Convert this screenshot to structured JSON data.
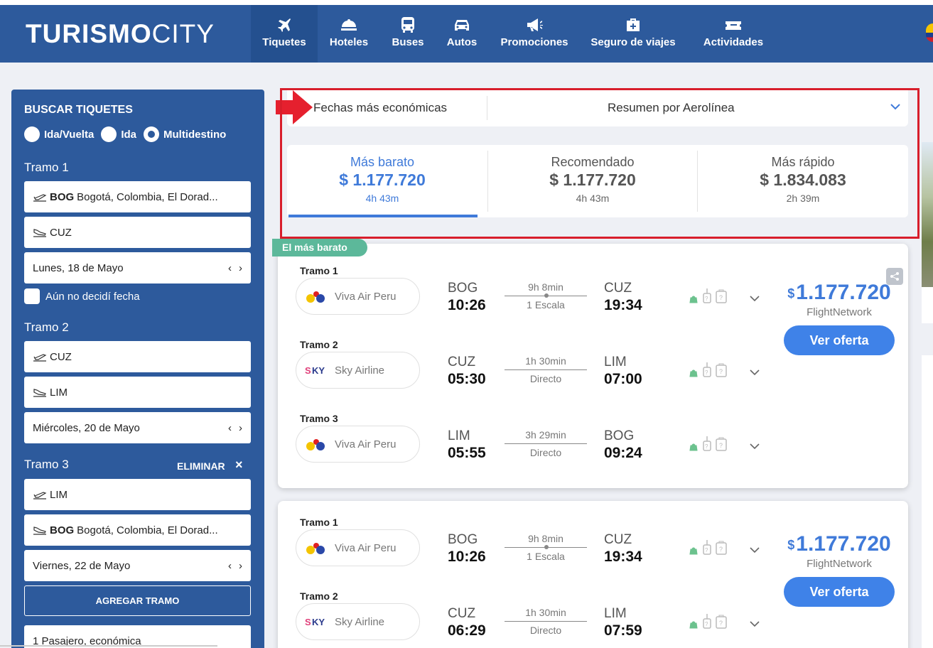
{
  "header": {
    "logo_bold": "TURISMO",
    "logo_light": "CITY",
    "nav": [
      {
        "label": "Tiquetes",
        "icon": "plane-icon",
        "active": true
      },
      {
        "label": "Hoteles",
        "icon": "hotel-bell-icon",
        "active": false
      },
      {
        "label": "Buses",
        "icon": "bus-icon",
        "active": false
      },
      {
        "label": "Autos",
        "icon": "car-icon",
        "active": false
      },
      {
        "label": "Promociones",
        "icon": "megaphone-icon",
        "active": false
      },
      {
        "label": "Seguro de viajes",
        "icon": "medical-case-icon",
        "active": false
      },
      {
        "label": "Actividades",
        "icon": "ticket-icon",
        "active": false
      }
    ]
  },
  "sidebar": {
    "title": "BUSCAR TIQUETES",
    "trip_types": [
      "Ida/Vuelta",
      "Ida",
      "Multidestino"
    ],
    "selected_trip_type": "Multidestino",
    "undecided_date": "Aún no decidí fecha",
    "tramos": [
      {
        "label": "Tramo 1",
        "origin_code": "BOG",
        "origin_name": "Bogotá, Colombia, El Dorad...",
        "dest_code": "",
        "dest_name": "CUZ",
        "date": "Lunes, 18 de Mayo"
      },
      {
        "label": "Tramo 2",
        "origin_code": "",
        "origin_name": "CUZ",
        "dest_code": "",
        "dest_name": "LIM",
        "date": "Miércoles, 20 de Mayo"
      },
      {
        "label": "Tramo 3",
        "origin_code": "",
        "origin_name": "LIM",
        "dest_code": "BOG",
        "dest_name": "Bogotá, Colombia, El Dorad...",
        "date": "Viernes, 22 de Mayo"
      }
    ],
    "remove_label": "ELIMINAR",
    "remove_x": "×",
    "add_label": "AGREGAR TRAMO",
    "passengers": "1 Pasajero, económica"
  },
  "filters": {
    "cheapest_dates": "Fechas más económicas",
    "airline_summary": "Resumen por Aerolínea"
  },
  "sort": [
    {
      "title": "Más barato",
      "price": "$ 1.177.720",
      "duration": "4h 43m",
      "active": true
    },
    {
      "title": "Recomendado",
      "price": "$ 1.177.720",
      "duration": "4h 43m",
      "active": false
    },
    {
      "title": "Más rápido",
      "price": "$ 1.834.083",
      "duration": "2h 39m",
      "active": false
    }
  ],
  "badge": "El más barato",
  "results": [
    {
      "price_currency": "$",
      "price": "1.177.720",
      "provider": "FlightNetwork",
      "cta": "Ver oferta",
      "legs": [
        {
          "title": "Tramo 1",
          "airline": "Viva Air Peru",
          "logo": "viva",
          "orig": "BOG",
          "dep": "10:26",
          "duration": "9h 8min",
          "stops": "1 Escala",
          "dest": "CUZ",
          "arr": "19:34"
        },
        {
          "title": "Tramo 2",
          "airline": "Sky Airline",
          "logo": "sky",
          "orig": "CUZ",
          "dep": "05:30",
          "duration": "1h 30min",
          "stops": "Directo",
          "dest": "LIM",
          "arr": "07:00"
        },
        {
          "title": "Tramo 3",
          "airline": "Viva Air Peru",
          "logo": "viva",
          "orig": "LIM",
          "dep": "05:55",
          "duration": "3h 29min",
          "stops": "Directo",
          "dest": "BOG",
          "arr": "09:24"
        }
      ]
    },
    {
      "price_currency": "$",
      "price": "1.177.720",
      "provider": "FlightNetwork",
      "cta": "Ver oferta",
      "legs": [
        {
          "title": "Tramo 1",
          "airline": "Viva Air Peru",
          "logo": "viva",
          "orig": "BOG",
          "dep": "10:26",
          "duration": "9h 8min",
          "stops": "1 Escala",
          "dest": "CUZ",
          "arr": "19:34"
        },
        {
          "title": "Tramo 2",
          "airline": "Sky Airline",
          "logo": "sky",
          "orig": "CUZ",
          "dep": "06:29",
          "duration": "1h 30min",
          "stops": "Directo",
          "dest": "LIM",
          "arr": "07:59"
        }
      ]
    }
  ],
  "colors": {
    "brand": "#2d5a9c",
    "accent": "#3f7ad9",
    "badge": "#5cb89a",
    "highlight": "#d81e2b"
  }
}
